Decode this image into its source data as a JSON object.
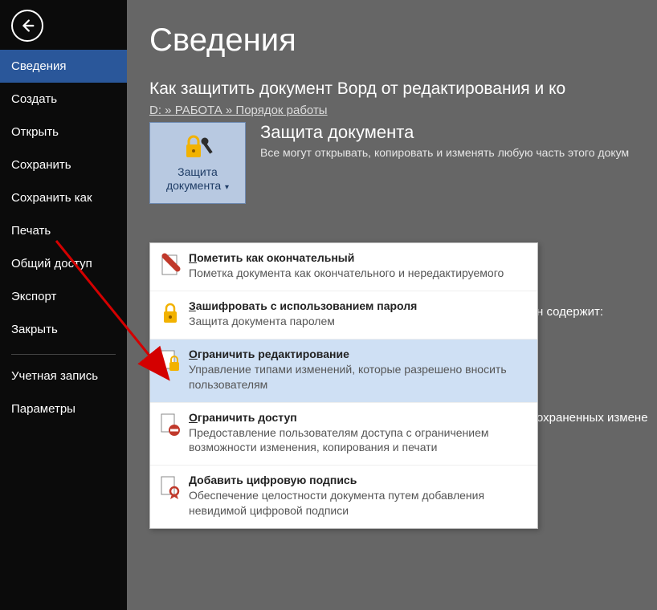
{
  "sidebar": {
    "items": [
      {
        "label": "Сведения",
        "active": true
      },
      {
        "label": "Создать"
      },
      {
        "label": "Открыть"
      },
      {
        "label": "Сохранить"
      },
      {
        "label": "Сохранить как"
      },
      {
        "label": "Печать"
      },
      {
        "label": "Общий доступ"
      },
      {
        "label": "Экспорт"
      },
      {
        "label": "Закрыть"
      }
    ],
    "bottom": [
      {
        "label": "Учетная запись"
      },
      {
        "label": "Параметры"
      }
    ]
  },
  "page": {
    "title": "Сведения",
    "doc_title": "Как защитить документ Ворд от редактирования и ко",
    "breadcrumb": {
      "a": "D:",
      "b": "РАБОТА",
      "c": "Порядок работы",
      "sep": " » "
    }
  },
  "protect_button": {
    "line1": "Защита",
    "line2": "документа"
  },
  "protect_section": {
    "heading": "Защита документа",
    "desc": "Все могут открывать, копировать и изменять любую часть этого докум"
  },
  "extra1": "н содержит:",
  "extra2": "охраненных измене",
  "dropdown": {
    "items": [
      {
        "title_pre": "П",
        "title_rest": "ометить как окончательный",
        "desc": "Пометка документа как окончательного и нередактируемого"
      },
      {
        "title_pre": "З",
        "title_rest": "ашифровать с использованием пароля",
        "desc": "Защита документа паролем"
      },
      {
        "title_pre": "О",
        "title_rest": "граничить редактирование",
        "desc": "Управление типами изменений, которые разрешено вносить пользователям"
      },
      {
        "title_pre": "О",
        "title_rest": "граничить доступ",
        "desc": "Предоставление пользователям доступа с ограничением возможности изменения, копирования и печати"
      },
      {
        "title_pre": "Д",
        "title_rest": "обавить цифровую подпись",
        "desc": "Обеспечение целостности документа путем добавления невидимой цифровой подписи"
      }
    ]
  }
}
